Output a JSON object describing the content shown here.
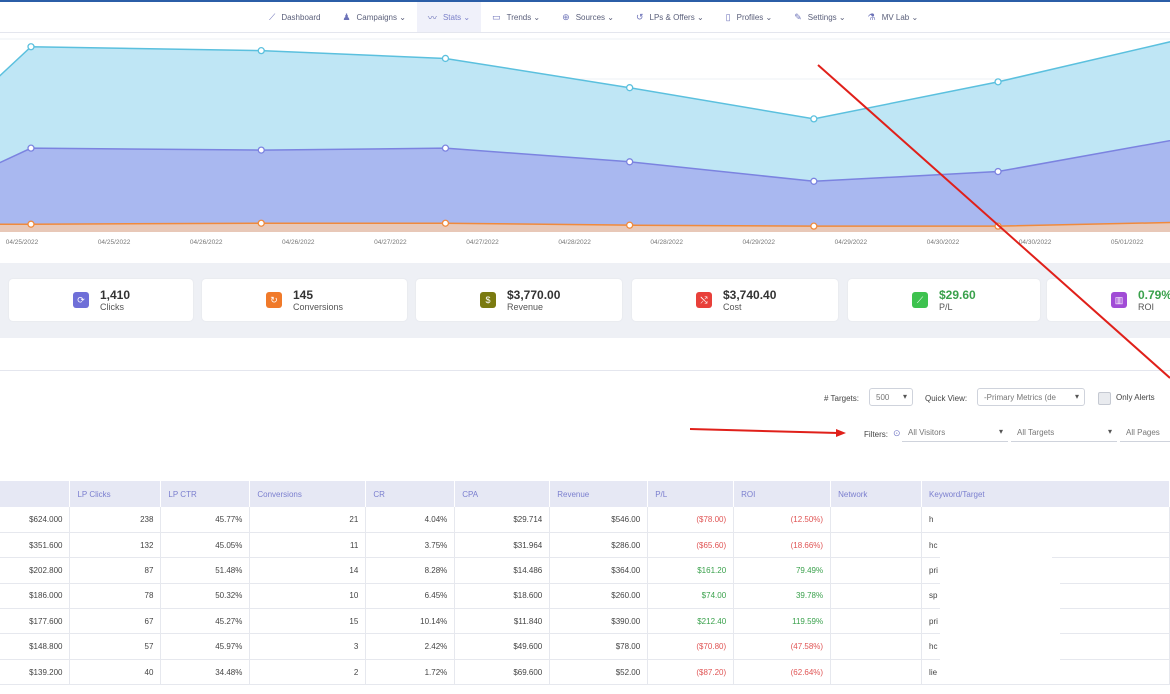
{
  "nav": {
    "items": [
      {
        "label": "Dashboard",
        "icon": "chart-line-icon",
        "glyph": "⟋"
      },
      {
        "label": "Campaigns ⌄",
        "icon": "user-icon",
        "glyph": "♟"
      },
      {
        "label": "Stats ⌄",
        "icon": "stats-icon",
        "glyph": "〰",
        "active": true
      },
      {
        "label": "Trends ⌄",
        "icon": "trends-icon",
        "glyph": "▭"
      },
      {
        "label": "Sources ⌄",
        "icon": "globe-icon",
        "glyph": "⊕"
      },
      {
        "label": "LPs & Offers ⌄",
        "icon": "refresh-icon",
        "glyph": "↺"
      },
      {
        "label": "Profiles ⌄",
        "icon": "document-icon",
        "glyph": "▯"
      },
      {
        "label": "Settings ⌄",
        "icon": "wrench-icon",
        "glyph": "✎"
      },
      {
        "label": "MV Lab ⌄",
        "icon": "lab-icon",
        "glyph": "⚗"
      }
    ]
  },
  "chart_data": {
    "type": "area",
    "x": [
      "04/25/2022",
      "04/25/2022",
      "04/26/2022",
      "04/26/2022",
      "04/27/2022",
      "04/27/2022",
      "04/28/2022",
      "04/28/2022",
      "04/29/2022",
      "04/29/2022",
      "04/30/2022",
      "04/30/2022",
      "05/01/2022"
    ],
    "x_tick_labels": [
      "04/25/2022",
      "04/25/2022",
      "04/26/2022",
      "04/26/2022",
      "04/27/2022",
      "04/27/2022",
      "04/28/2022",
      "04/28/2022",
      "04/29/2022",
      "04/29/2022",
      "04/30/2022",
      "04/30/2022",
      "05/01/2022"
    ],
    "series": [
      {
        "color": "#5bc0de",
        "fill": "#bfe6f5",
        "points": [
          [
            0.0,
            0.73
          ],
          [
            0.5,
            0.95
          ],
          [
            3.0,
            0.93
          ],
          [
            5.0,
            0.89
          ],
          [
            7.0,
            0.74
          ],
          [
            9.0,
            0.58
          ],
          [
            11.0,
            0.77
          ],
          [
            13.0,
            0.99
          ],
          [
            13.5,
            0.81
          ]
        ]
      },
      {
        "color": "#7b83e0",
        "fill": "#a9b8f0",
        "points": [
          [
            0.0,
            0.32
          ],
          [
            0.5,
            0.43
          ],
          [
            3.0,
            0.42
          ],
          [
            5.0,
            0.43
          ],
          [
            7.0,
            0.36
          ],
          [
            9.0,
            0.26
          ],
          [
            11.0,
            0.31
          ],
          [
            13.0,
            0.48
          ],
          [
            13.5,
            0.39
          ]
        ]
      },
      {
        "color": "#f08a3c",
        "fill": "#e8c8b8",
        "points": [
          [
            0.0,
            0.04
          ],
          [
            0.5,
            0.04
          ],
          [
            3.0,
            0.045
          ],
          [
            5.0,
            0.045
          ],
          [
            7.0,
            0.035
          ],
          [
            9.0,
            0.03
          ],
          [
            11.0,
            0.03
          ],
          [
            13.0,
            0.05
          ],
          [
            13.5,
            0.04
          ]
        ]
      }
    ]
  },
  "summary": [
    {
      "value": "1,410",
      "label": "Clicks",
      "icon": "clicks-icon",
      "glyph": "⟳",
      "color": "#6f6fd8",
      "value_color": "#333333"
    },
    {
      "value": "145",
      "label": "Conversions",
      "icon": "conversions-icon",
      "glyph": "↻",
      "color": "#f07a2a",
      "value_color": "#333333"
    },
    {
      "value": "$3,770.00",
      "label": "Revenue",
      "icon": "revenue-icon",
      "glyph": "$",
      "color": "#7a7a10",
      "value_color": "#333333"
    },
    {
      "value": "$3,740.40",
      "label": "Cost",
      "icon": "cost-icon",
      "glyph": "⤭",
      "color": "#e8403a",
      "value_color": "#333333"
    },
    {
      "value": "$29.60",
      "label": "P/L",
      "icon": "pl-icon",
      "glyph": "⟋",
      "color": "#3ec24f",
      "value_color": "#3aa14c"
    },
    {
      "value": "0.79%",
      "label": "ROI",
      "icon": "roi-icon",
      "glyph": "▥",
      "color": "#a14cd6",
      "value_color": "#3aa14c"
    }
  ],
  "controls": {
    "targets_label": "# Targets:",
    "targets_value": "500",
    "quick_view_label": "Quick View:",
    "quick_view_value": "-Primary Metrics (de",
    "only_alerts_label": "Only Alerts",
    "filters_label": "Filters:",
    "visitors_value": "All Visitors",
    "targets_filter_value": "All Targets",
    "pages_value": "All Pages"
  },
  "table": {
    "headers": [
      "",
      "LP Clicks",
      "LP CTR",
      "Conversions",
      "CR",
      "CPA",
      "Revenue",
      "P/L",
      "ROI",
      "Network",
      "Keyword/Target"
    ],
    "rows": [
      [
        "$624.000",
        "238",
        "45.77%",
        "21",
        "4.04%",
        "$29.714",
        "$546.00",
        "($78.00)",
        "(12.50%)",
        "",
        "h"
      ],
      [
        "$351.600",
        "132",
        "45.05%",
        "11",
        "3.75%",
        "$31.964",
        "$286.00",
        "($65.60)",
        "(18.66%)",
        "",
        "hc"
      ],
      [
        "$202.800",
        "87",
        "51.48%",
        "14",
        "8.28%",
        "$14.486",
        "$364.00",
        "$161.20",
        "79.49%",
        "",
        "pri"
      ],
      [
        "$186.000",
        "78",
        "50.32%",
        "10",
        "6.45%",
        "$18.600",
        "$260.00",
        "$74.00",
        "39.78%",
        "",
        "sp"
      ],
      [
        "$177.600",
        "67",
        "45.27%",
        "15",
        "10.14%",
        "$11.840",
        "$390.00",
        "$212.40",
        "119.59%",
        "",
        "pri"
      ],
      [
        "$148.800",
        "57",
        "45.97%",
        "3",
        "2.42%",
        "$49.600",
        "$78.00",
        "($70.80)",
        "(47.58%)",
        "",
        "hc                                    ng"
      ],
      [
        "$139.200",
        "40",
        "34.48%",
        "2",
        "1.72%",
        "$69.600",
        "$52.00",
        "($87.20)",
        "(62.64%)",
        "",
        "lie"
      ]
    ]
  },
  "colors": {
    "negative": "#e05555",
    "positive": "#3aa14c",
    "header_text": "#7b7fcf",
    "annotation_arrow": "#e0201a"
  }
}
